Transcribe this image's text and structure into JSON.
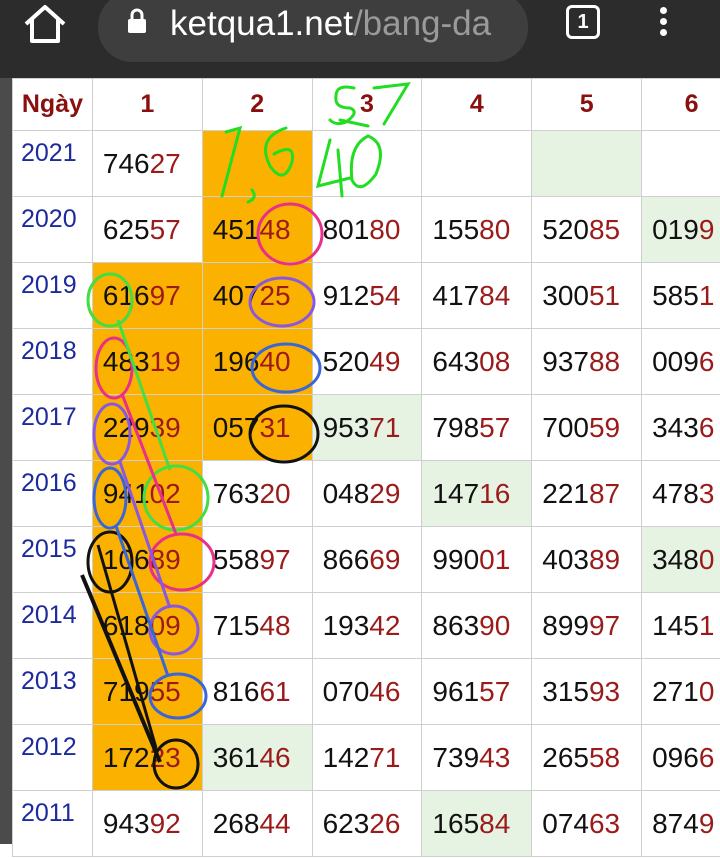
{
  "browser": {
    "url_host": "ketqua1.net",
    "url_path": "/bang-da",
    "tab_count": "1",
    "icons": [
      "home-icon",
      "lock-icon",
      "tabs-icon",
      "menu-icon"
    ]
  },
  "table": {
    "headers": [
      "Ngày",
      "1",
      "2",
      "3",
      "4",
      "5",
      "6"
    ],
    "rows": [
      {
        "year": "2021",
        "cells": [
          [
            "746",
            "27"
          ],
          [
            "",
            ""
          ],
          [
            "",
            ""
          ],
          [
            "",
            ""
          ],
          [
            "",
            ""
          ],
          [
            "",
            ""
          ]
        ]
      },
      {
        "year": "2020",
        "cells": [
          [
            "625",
            "57"
          ],
          [
            "451",
            "48"
          ],
          [
            "801",
            "80"
          ],
          [
            "155",
            "80"
          ],
          [
            "520",
            "85"
          ],
          [
            "019",
            "9"
          ]
        ]
      },
      {
        "year": "2019",
        "cells": [
          [
            "616",
            "97"
          ],
          [
            "407",
            "25"
          ],
          [
            "912",
            "54"
          ],
          [
            "417",
            "84"
          ],
          [
            "300",
            "51"
          ],
          [
            "585",
            "1"
          ]
        ]
      },
      {
        "year": "2018",
        "cells": [
          [
            "483",
            "19"
          ],
          [
            "196",
            "40"
          ],
          [
            "520",
            "49"
          ],
          [
            "643",
            "08"
          ],
          [
            "937",
            "88"
          ],
          [
            "009",
            "6"
          ]
        ]
      },
      {
        "year": "2017",
        "cells": [
          [
            "229",
            "39"
          ],
          [
            "057",
            "31"
          ],
          [
            "953",
            "71"
          ],
          [
            "798",
            "57"
          ],
          [
            "700",
            "59"
          ],
          [
            "343",
            "6"
          ]
        ]
      },
      {
        "year": "2016",
        "cells": [
          [
            "941",
            "02"
          ],
          [
            "763",
            "20"
          ],
          [
            "048",
            "29"
          ],
          [
            "147",
            "16"
          ],
          [
            "221",
            "87"
          ],
          [
            "478",
            "3"
          ]
        ]
      },
      {
        "year": "2015",
        "cells": [
          [
            "106",
            "89"
          ],
          [
            "558",
            "97"
          ],
          [
            "866",
            "69"
          ],
          [
            "990",
            "01"
          ],
          [
            "403",
            "89"
          ],
          [
            "348",
            "0"
          ]
        ]
      },
      {
        "year": "2014",
        "cells": [
          [
            "618",
            "09"
          ],
          [
            "715",
            "48"
          ],
          [
            "193",
            "42"
          ],
          [
            "863",
            "90"
          ],
          [
            "899",
            "97"
          ],
          [
            "145",
            "1"
          ]
        ]
      },
      {
        "year": "2013",
        "cells": [
          [
            "719",
            "55"
          ],
          [
            "816",
            "61"
          ],
          [
            "070",
            "46"
          ],
          [
            "961",
            "57"
          ],
          [
            "315",
            "93"
          ],
          [
            "271",
            "0"
          ]
        ]
      },
      {
        "year": "2012",
        "cells": [
          [
            "172",
            "23"
          ],
          [
            "361",
            "46"
          ],
          [
            "142",
            "71"
          ],
          [
            "739",
            "43"
          ],
          [
            "265",
            "58"
          ],
          [
            "096",
            "6"
          ]
        ]
      },
      {
        "year": "2011",
        "cells": [
          [
            "943",
            "92"
          ],
          [
            "268",
            "44"
          ],
          [
            "623",
            "26"
          ],
          [
            "165",
            "84"
          ],
          [
            "074",
            "63"
          ],
          [
            "874",
            "9"
          ]
        ]
      }
    ]
  },
  "colors": {
    "highlight": "#fbb100",
    "match": "#e6f3e3",
    "year_text": "#1c2a9c",
    "tail_text": "#9b1b1b",
    "header_text": "#8a1010",
    "chrome": "#2c2c2c"
  },
  "handwriting": {
    "text": [
      "1,6",
      "5 7",
      "40"
    ]
  }
}
